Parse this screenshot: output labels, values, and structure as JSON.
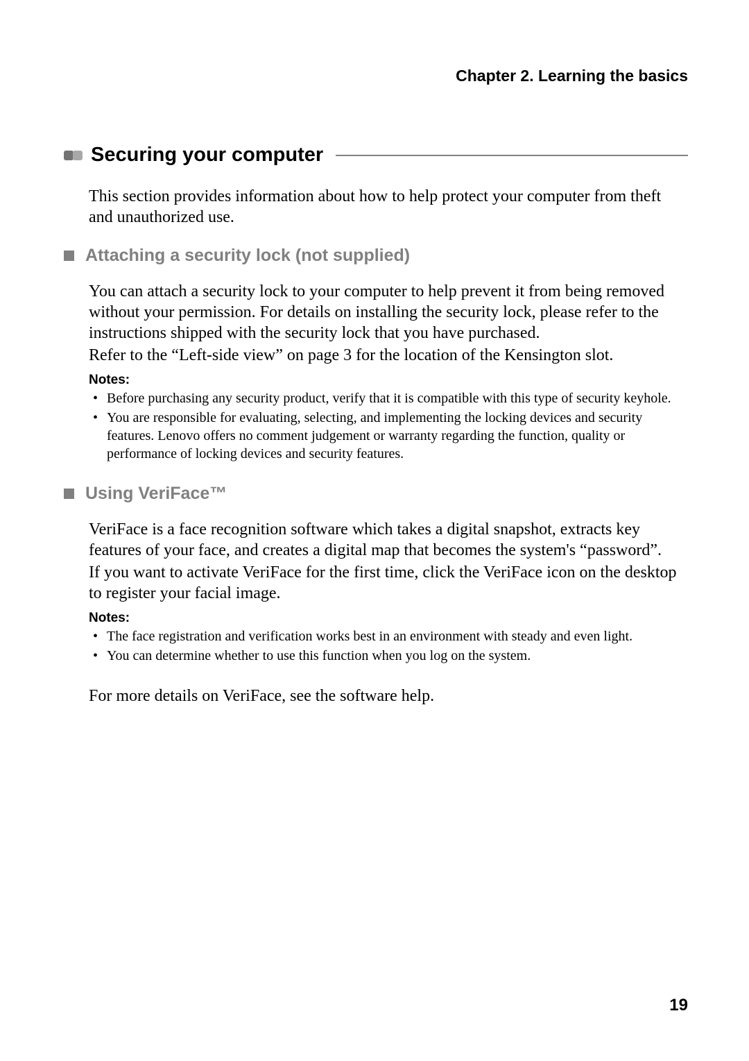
{
  "chapter_header": "Chapter 2. Learning the basics",
  "section": {
    "title": "Securing your computer",
    "intro": "This section provides information about how to help protect your computer from theft and unauthorized use."
  },
  "sub1": {
    "title": "Attaching a security lock (not supplied)",
    "p1": "You can attach a security lock to your computer to help prevent it from being removed without your permission. For details on installing the security lock, please refer to the instructions shipped with the security lock that you have purchased.",
    "p2": "Refer to the “Left-side view” on page 3 for the location of the Kensington slot.",
    "notes_label": "Notes:",
    "notes": [
      "Before purchasing any security product, verify that it is compatible with this type of security keyhole.",
      "You are responsible for evaluating, selecting, and implementing the locking devices and security features. Lenovo offers no comment judgement or warranty regarding the function, quality or performance of locking devices and security features."
    ]
  },
  "sub2": {
    "title": "Using VeriFace™",
    "p1": "VeriFace is a face recognition software which takes a digital snapshot, extracts key features of your face, and creates a digital map that becomes the system's “password”.",
    "p2": "If you want to activate VeriFace for the first time, click the VeriFace icon on the desktop to register your facial image.",
    "notes_label": "Notes:",
    "notes": [
      "The face registration and verification works best in an environment with steady and even light.",
      "You can determine whether to use this function when you log on the system."
    ],
    "closing": "For more details on VeriFace, see the software help."
  },
  "page_number": "19"
}
